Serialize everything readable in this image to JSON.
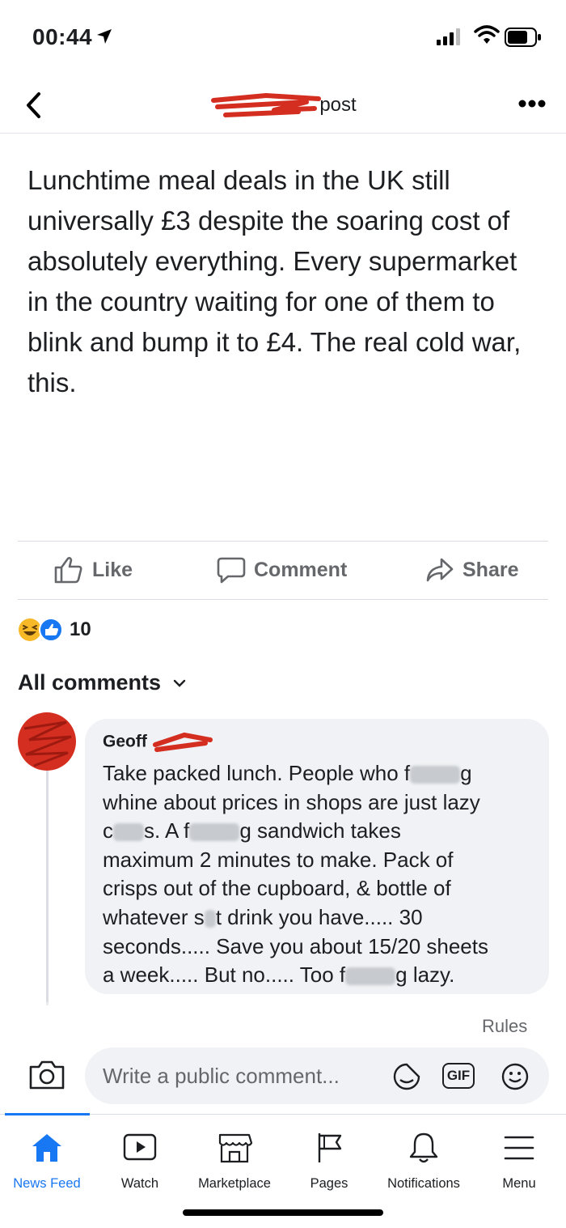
{
  "status_bar": {
    "time": "00:44"
  },
  "header": {
    "title_suffix": "post",
    "more_label": "•••"
  },
  "post": {
    "text": "Lunchtime meal deals in the UK still universally £3 despite the soaring cost of absolutely everything. Every supermarket in the country waiting for one of them to blink and bump it to £4. The real cold war, this."
  },
  "actions": {
    "like": "Like",
    "comment": "Comment",
    "share": "Share"
  },
  "reactions": {
    "count": "10"
  },
  "comments_filter": {
    "label": "All comments"
  },
  "comment": {
    "author": "Geoff",
    "lines": [
      [
        "Take packed lunch. People who f",
        "g"
      ],
      [
        "whine about prices in shops are just lazy"
      ],
      [
        "c",
        "s. A f",
        "g sandwich takes"
      ],
      [
        "maximum 2 minutes to make. Pack of"
      ],
      [
        "crisps out of the cupboard, & bottle of"
      ],
      [
        "whatever s",
        "t drink you have..... 30"
      ],
      [
        "seconds..... Save you about 15/20 sheets"
      ],
      [
        "a week..... But no..... Too f",
        "g lazy."
      ]
    ]
  },
  "rules_label": "Rules",
  "composer": {
    "placeholder": "Write a public comment...",
    "gif_label": "GIF"
  },
  "tabs": [
    {
      "label": "News Feed",
      "icon": "home-icon",
      "active": true
    },
    {
      "label": "Watch",
      "icon": "watch-icon"
    },
    {
      "label": "Marketplace",
      "icon": "marketplace-icon"
    },
    {
      "label": "Pages",
      "icon": "flag-icon"
    },
    {
      "label": "Notifications",
      "icon": "bell-icon"
    },
    {
      "label": "Menu",
      "icon": "menu-icon"
    }
  ],
  "colors": {
    "accent": "#1877f2",
    "text": "#1c1e21",
    "muted": "#65676b",
    "bubble": "#f0f2f5",
    "redaction": "#d42e20"
  }
}
